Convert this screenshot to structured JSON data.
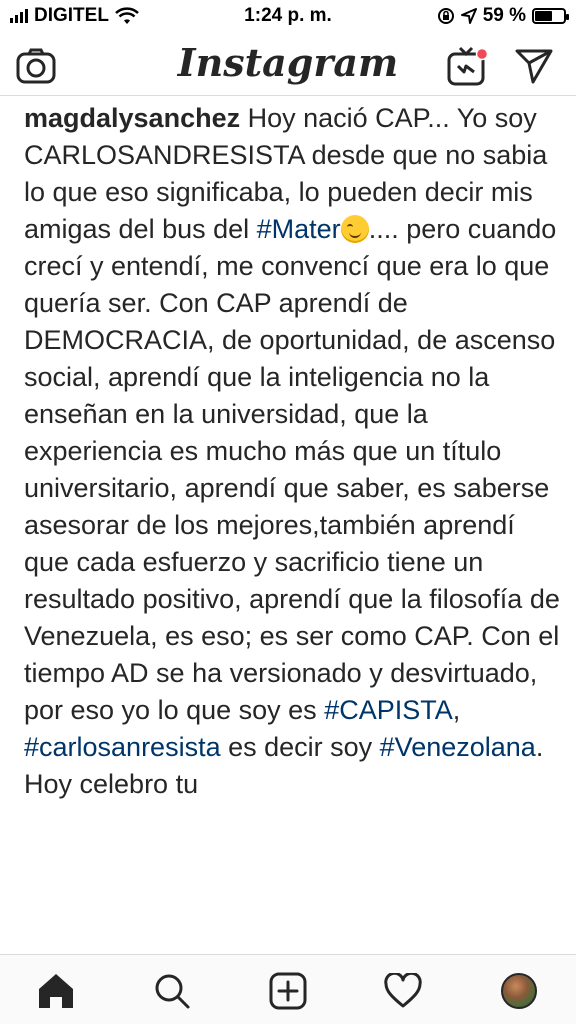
{
  "status_bar": {
    "carrier": "DIGITEL",
    "time": "1:24 p. m.",
    "battery_percent": "59 %",
    "battery_level": 0.59,
    "icons": [
      "signal-icon",
      "wifi-icon",
      "orientation-lock-icon",
      "location-icon",
      "battery-icon"
    ]
  },
  "header": {
    "title": "Instagram",
    "icons": [
      "camera-icon",
      "igtv-icon",
      "direct-icon"
    ],
    "notification_dot_color": "#ed4956"
  },
  "post": {
    "username": "magdalysanchez",
    "caption_parts": [
      {
        "type": "text",
        "text": " Hoy nació CAP... Yo soy CARLOSANDRESISTA desde que no sabia lo que eso significaba, lo pueden decir mis amigas del bus del "
      },
      {
        "type": "tag",
        "text": "#Mater"
      },
      {
        "type": "text",
        "text": ".... pero cuando crecí y entendí, me convencí que era lo que quería ser.  Con CAP aprendí de DEMOCRACIA, de oportunidad, de ascenso social, aprendí que la inteligencia no la enseñan en la universidad, que la experiencia es mucho más que un título universitario, aprendí que saber, es saberse asesorar de los mejores,también aprendí que cada esfuerzo y sacrificio tiene un resultado positivo, aprendí que la filosofía de Venezuela, es eso; es ser como CAP.  Con el tiempo AD se ha versionado y desvirtuado,  por eso yo lo que soy es "
      },
      {
        "type": "tag",
        "text": "#CAPISTA"
      },
      {
        "type": "text",
        "text": ", "
      },
      {
        "type": "tag",
        "text": "#carlosanresista"
      },
      {
        "type": "text",
        "text": " es decir soy "
      },
      {
        "type": "tag",
        "text": "#Venezolana"
      },
      {
        "type": "text",
        "text": ".  Hoy celebro tu"
      }
    ],
    "emoji": "winking-face-emoji",
    "hashtag_color": "#003569"
  },
  "bottom_nav": {
    "items": [
      "home-icon",
      "search-icon",
      "add-post-icon",
      "activity-heart-icon",
      "profile-avatar"
    ]
  }
}
